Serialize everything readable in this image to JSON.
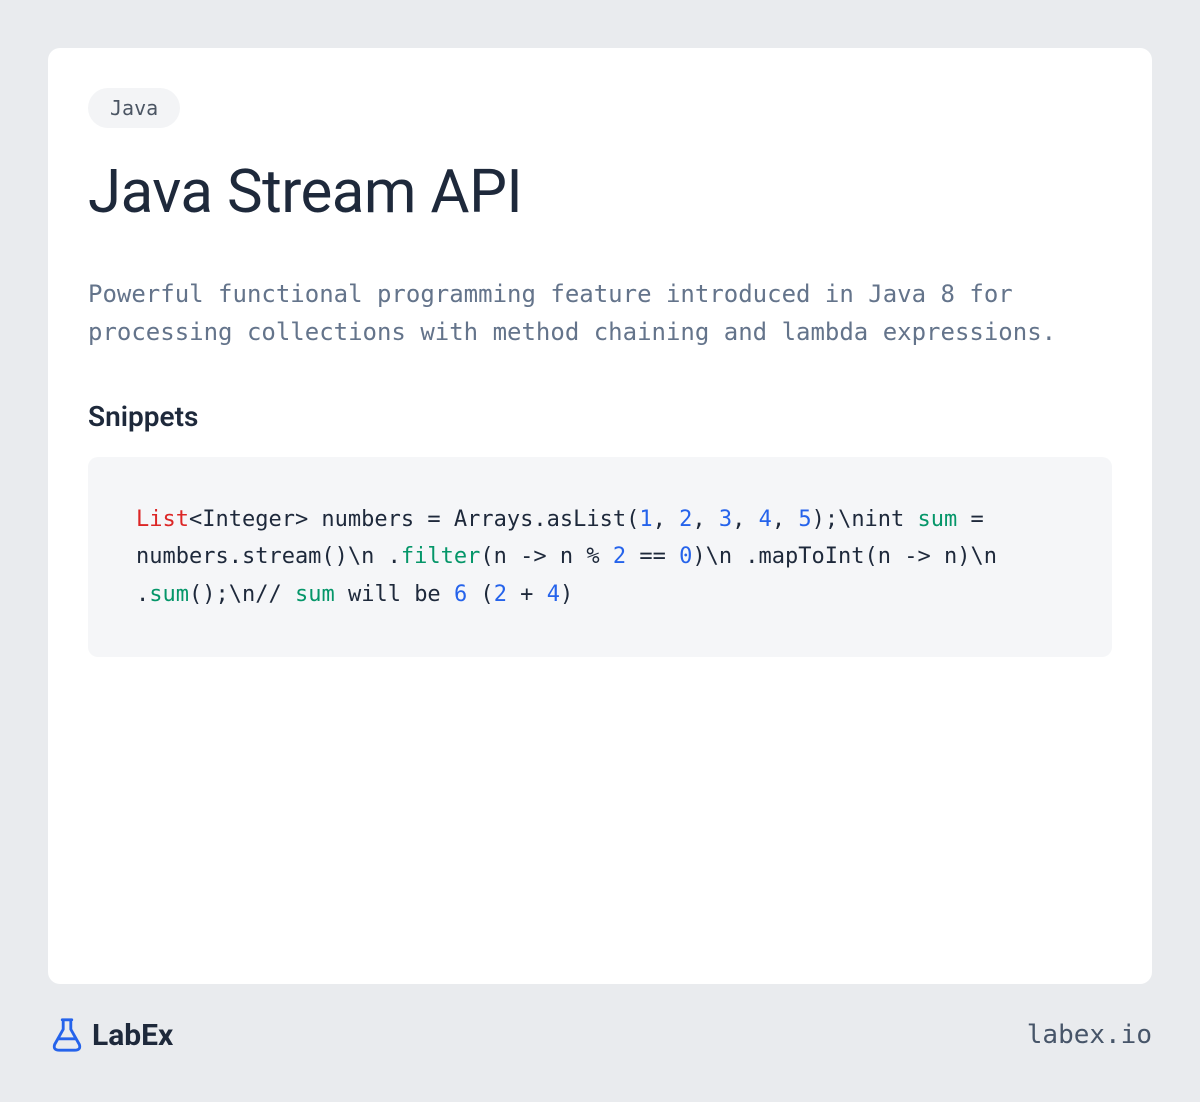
{
  "tag": "Java",
  "title": "Java Stream API",
  "description": "Powerful functional programming feature introduced in Java 8 for processing collections with method chaining and lambda expressions.",
  "snippets_heading": "Snippets",
  "code": {
    "tokens": [
      {
        "text": "List",
        "class": "keyword-red"
      },
      {
        "text": "<Integer> numbers = Arrays.asList(",
        "class": ""
      },
      {
        "text": "1",
        "class": "number"
      },
      {
        "text": ", ",
        "class": ""
      },
      {
        "text": "2",
        "class": "number"
      },
      {
        "text": ", ",
        "class": ""
      },
      {
        "text": "3",
        "class": "number"
      },
      {
        "text": ", ",
        "class": ""
      },
      {
        "text": "4",
        "class": "number"
      },
      {
        "text": ", ",
        "class": ""
      },
      {
        "text": "5",
        "class": "number"
      },
      {
        "text": ");\\nint ",
        "class": ""
      },
      {
        "text": "sum",
        "class": "keyword-green"
      },
      {
        "text": " = numbers.stream()\\n    .",
        "class": ""
      },
      {
        "text": "filter",
        "class": "keyword-green"
      },
      {
        "text": "(n -> n % ",
        "class": ""
      },
      {
        "text": "2",
        "class": "number"
      },
      {
        "text": " == ",
        "class": ""
      },
      {
        "text": "0",
        "class": "number"
      },
      {
        "text": ")\\n    .mapToInt(n -> n)\\n    .",
        "class": ""
      },
      {
        "text": "sum",
        "class": "keyword-green"
      },
      {
        "text": "();\\n// ",
        "class": ""
      },
      {
        "text": "sum",
        "class": "keyword-green"
      },
      {
        "text": " will be ",
        "class": ""
      },
      {
        "text": "6",
        "class": "number"
      },
      {
        "text": " (",
        "class": ""
      },
      {
        "text": "2",
        "class": "number"
      },
      {
        "text": " + ",
        "class": ""
      },
      {
        "text": "4",
        "class": "number"
      },
      {
        "text": ")",
        "class": ""
      }
    ]
  },
  "footer": {
    "brand": "LabEx",
    "url": "labex.io"
  }
}
